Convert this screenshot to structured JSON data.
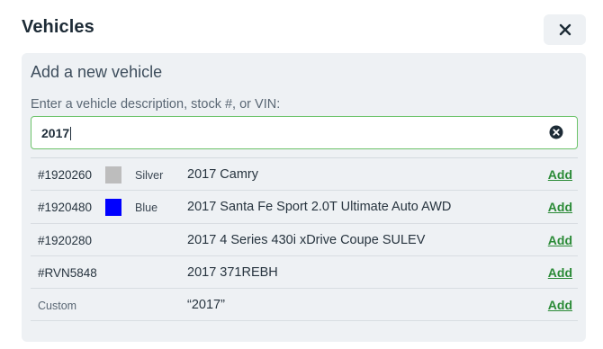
{
  "modal": {
    "title": "Vehicles",
    "close_icon": "close-icon"
  },
  "panel": {
    "title": "Add a new vehicle",
    "search_label": "Enter a vehicle description, stock #, or VIN:",
    "search_value": "2017",
    "search_border_color": "#6cc36a",
    "clear_icon": "clear-circle-icon"
  },
  "results": [
    {
      "stock": "#1920260",
      "swatch_color": "#bdbdbd",
      "color_name": "Silver",
      "description": "2017 Camry",
      "action": "Add"
    },
    {
      "stock": "#1920480",
      "swatch_color": "#0000ff",
      "color_name": "Blue",
      "description": "2017 Santa Fe Sport 2.0T Ultimate Auto AWD",
      "action": "Add"
    },
    {
      "stock": "#1920280",
      "swatch_color": "",
      "color_name": "",
      "description": "2017 4 Series 430i xDrive Coupe SULEV",
      "action": "Add"
    },
    {
      "stock": "#RVN5848",
      "swatch_color": "",
      "color_name": "",
      "description": "2017 371REBH",
      "action": "Add"
    },
    {
      "stock": "Custom",
      "swatch_color": "",
      "color_name": "",
      "description": "“2017”",
      "action": "Add"
    }
  ],
  "colors": {
    "action_link": "#2a8a36",
    "panel_background": "#eef1f4"
  }
}
